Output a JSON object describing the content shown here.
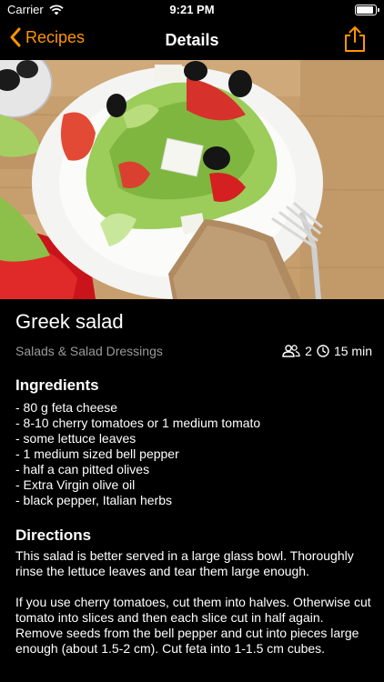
{
  "status": {
    "carrier": "Carrier",
    "time": "9:21 PM",
    "battery_level": 0.95
  },
  "nav": {
    "back_label": "Recipes",
    "title": "Details"
  },
  "recipe": {
    "title": "Greek salad",
    "category": "Salads & Salad Dressings",
    "servings": "2",
    "time": "15 min",
    "ingredients_heading": "Ingredients",
    "ingredients": [
      "- 80 g feta cheese",
      "- 8-10 cherry tomatoes or 1 medium tomato",
      "- some lettuce leaves",
      "- 1 medium sized bell pepper",
      "- half a can pitted olives",
      "- Extra Virgin olive oil",
      "- black pepper, Italian herbs"
    ],
    "directions_heading": "Directions",
    "directions": [
      "This salad is better served in a large glass bowl. Thoroughly rinse the lettuce leaves and tear them large enough.",
      "If you use cherry tomatoes, cut them into halves. Otherwise cut tomato into slices and then each slice cut in half again.  Remove seeds from the bell pepper and cut into pieces large enough (about 1.5-2 cm). Cut feta into 1-1.5 cm cubes."
    ]
  },
  "colors": {
    "accent": "#ff9500",
    "secondary_text": "#9a9a9a",
    "background": "#000000"
  }
}
